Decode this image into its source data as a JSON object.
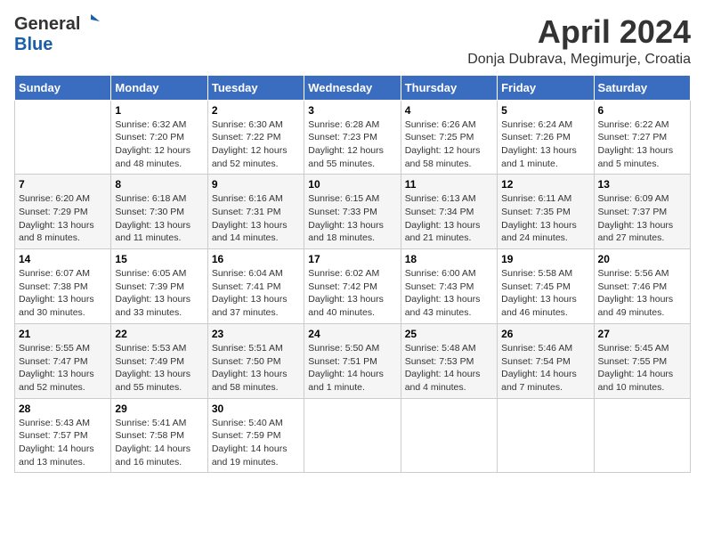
{
  "header": {
    "logo_general": "General",
    "logo_blue": "Blue",
    "month_title": "April 2024",
    "location": "Donja Dubrava, Megimurje, Croatia"
  },
  "days_of_week": [
    "Sunday",
    "Monday",
    "Tuesday",
    "Wednesday",
    "Thursday",
    "Friday",
    "Saturday"
  ],
  "weeks": [
    {
      "row_class": "week-row-1",
      "days": [
        {
          "date": "",
          "sunrise": "",
          "sunset": "",
          "daylight": ""
        },
        {
          "date": "1",
          "sunrise": "Sunrise: 6:32 AM",
          "sunset": "Sunset: 7:20 PM",
          "daylight": "Daylight: 12 hours and 48 minutes."
        },
        {
          "date": "2",
          "sunrise": "Sunrise: 6:30 AM",
          "sunset": "Sunset: 7:22 PM",
          "daylight": "Daylight: 12 hours and 52 minutes."
        },
        {
          "date": "3",
          "sunrise": "Sunrise: 6:28 AM",
          "sunset": "Sunset: 7:23 PM",
          "daylight": "Daylight: 12 hours and 55 minutes."
        },
        {
          "date": "4",
          "sunrise": "Sunrise: 6:26 AM",
          "sunset": "Sunset: 7:25 PM",
          "daylight": "Daylight: 12 hours and 58 minutes."
        },
        {
          "date": "5",
          "sunrise": "Sunrise: 6:24 AM",
          "sunset": "Sunset: 7:26 PM",
          "daylight": "Daylight: 13 hours and 1 minute."
        },
        {
          "date": "6",
          "sunrise": "Sunrise: 6:22 AM",
          "sunset": "Sunset: 7:27 PM",
          "daylight": "Daylight: 13 hours and 5 minutes."
        }
      ]
    },
    {
      "row_class": "week-row-2",
      "days": [
        {
          "date": "7",
          "sunrise": "Sunrise: 6:20 AM",
          "sunset": "Sunset: 7:29 PM",
          "daylight": "Daylight: 13 hours and 8 minutes."
        },
        {
          "date": "8",
          "sunrise": "Sunrise: 6:18 AM",
          "sunset": "Sunset: 7:30 PM",
          "daylight": "Daylight: 13 hours and 11 minutes."
        },
        {
          "date": "9",
          "sunrise": "Sunrise: 6:16 AM",
          "sunset": "Sunset: 7:31 PM",
          "daylight": "Daylight: 13 hours and 14 minutes."
        },
        {
          "date": "10",
          "sunrise": "Sunrise: 6:15 AM",
          "sunset": "Sunset: 7:33 PM",
          "daylight": "Daylight: 13 hours and 18 minutes."
        },
        {
          "date": "11",
          "sunrise": "Sunrise: 6:13 AM",
          "sunset": "Sunset: 7:34 PM",
          "daylight": "Daylight: 13 hours and 21 minutes."
        },
        {
          "date": "12",
          "sunrise": "Sunrise: 6:11 AM",
          "sunset": "Sunset: 7:35 PM",
          "daylight": "Daylight: 13 hours and 24 minutes."
        },
        {
          "date": "13",
          "sunrise": "Sunrise: 6:09 AM",
          "sunset": "Sunset: 7:37 PM",
          "daylight": "Daylight: 13 hours and 27 minutes."
        }
      ]
    },
    {
      "row_class": "week-row-3",
      "days": [
        {
          "date": "14",
          "sunrise": "Sunrise: 6:07 AM",
          "sunset": "Sunset: 7:38 PM",
          "daylight": "Daylight: 13 hours and 30 minutes."
        },
        {
          "date": "15",
          "sunrise": "Sunrise: 6:05 AM",
          "sunset": "Sunset: 7:39 PM",
          "daylight": "Daylight: 13 hours and 33 minutes."
        },
        {
          "date": "16",
          "sunrise": "Sunrise: 6:04 AM",
          "sunset": "Sunset: 7:41 PM",
          "daylight": "Daylight: 13 hours and 37 minutes."
        },
        {
          "date": "17",
          "sunrise": "Sunrise: 6:02 AM",
          "sunset": "Sunset: 7:42 PM",
          "daylight": "Daylight: 13 hours and 40 minutes."
        },
        {
          "date": "18",
          "sunrise": "Sunrise: 6:00 AM",
          "sunset": "Sunset: 7:43 PM",
          "daylight": "Daylight: 13 hours and 43 minutes."
        },
        {
          "date": "19",
          "sunrise": "Sunrise: 5:58 AM",
          "sunset": "Sunset: 7:45 PM",
          "daylight": "Daylight: 13 hours and 46 minutes."
        },
        {
          "date": "20",
          "sunrise": "Sunrise: 5:56 AM",
          "sunset": "Sunset: 7:46 PM",
          "daylight": "Daylight: 13 hours and 49 minutes."
        }
      ]
    },
    {
      "row_class": "week-row-4",
      "days": [
        {
          "date": "21",
          "sunrise": "Sunrise: 5:55 AM",
          "sunset": "Sunset: 7:47 PM",
          "daylight": "Daylight: 13 hours and 52 minutes."
        },
        {
          "date": "22",
          "sunrise": "Sunrise: 5:53 AM",
          "sunset": "Sunset: 7:49 PM",
          "daylight": "Daylight: 13 hours and 55 minutes."
        },
        {
          "date": "23",
          "sunrise": "Sunrise: 5:51 AM",
          "sunset": "Sunset: 7:50 PM",
          "daylight": "Daylight: 13 hours and 58 minutes."
        },
        {
          "date": "24",
          "sunrise": "Sunrise: 5:50 AM",
          "sunset": "Sunset: 7:51 PM",
          "daylight": "Daylight: 14 hours and 1 minute."
        },
        {
          "date": "25",
          "sunrise": "Sunrise: 5:48 AM",
          "sunset": "Sunset: 7:53 PM",
          "daylight": "Daylight: 14 hours and 4 minutes."
        },
        {
          "date": "26",
          "sunrise": "Sunrise: 5:46 AM",
          "sunset": "Sunset: 7:54 PM",
          "daylight": "Daylight: 14 hours and 7 minutes."
        },
        {
          "date": "27",
          "sunrise": "Sunrise: 5:45 AM",
          "sunset": "Sunset: 7:55 PM",
          "daylight": "Daylight: 14 hours and 10 minutes."
        }
      ]
    },
    {
      "row_class": "week-row-5",
      "days": [
        {
          "date": "28",
          "sunrise": "Sunrise: 5:43 AM",
          "sunset": "Sunset: 7:57 PM",
          "daylight": "Daylight: 14 hours and 13 minutes."
        },
        {
          "date": "29",
          "sunrise": "Sunrise: 5:41 AM",
          "sunset": "Sunset: 7:58 PM",
          "daylight": "Daylight: 14 hours and 16 minutes."
        },
        {
          "date": "30",
          "sunrise": "Sunrise: 5:40 AM",
          "sunset": "Sunset: 7:59 PM",
          "daylight": "Daylight: 14 hours and 19 minutes."
        },
        {
          "date": "",
          "sunrise": "",
          "sunset": "",
          "daylight": ""
        },
        {
          "date": "",
          "sunrise": "",
          "sunset": "",
          "daylight": ""
        },
        {
          "date": "",
          "sunrise": "",
          "sunset": "",
          "daylight": ""
        },
        {
          "date": "",
          "sunrise": "",
          "sunset": "",
          "daylight": ""
        }
      ]
    }
  ]
}
